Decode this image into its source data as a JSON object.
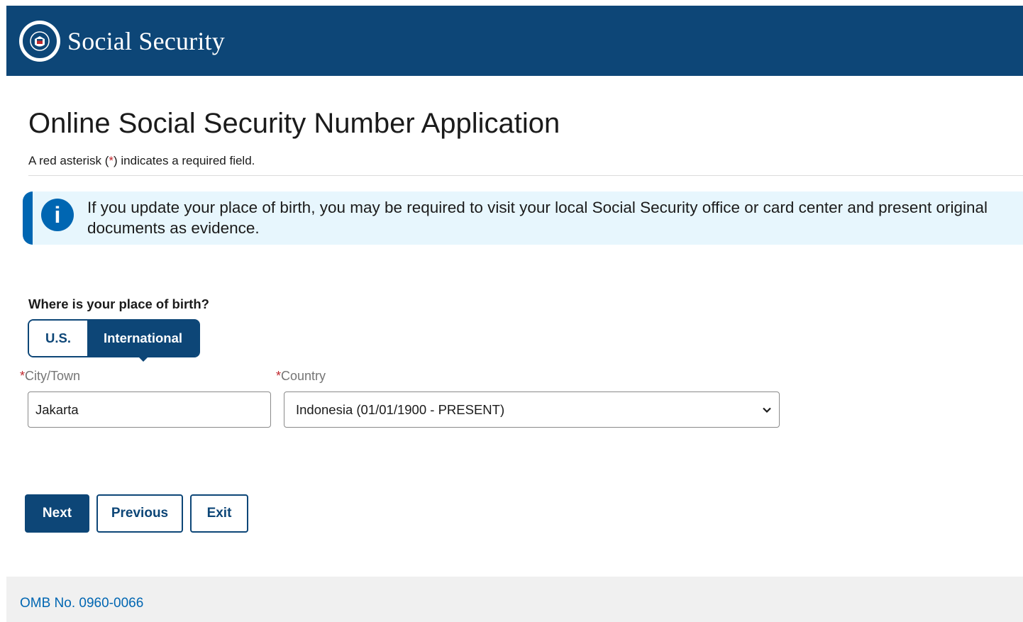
{
  "header": {
    "brand": "Social Security",
    "logo_icon": "ssa-seal-icon"
  },
  "page": {
    "title": "Online Social Security Number Application",
    "required_note_before": "A red asterisk (",
    "required_note_star": "*",
    "required_note_after": ") indicates a required field."
  },
  "alert": {
    "icon": "info-icon",
    "text": "If you update your place of birth, you may be required to visit your local Social Security office or card center and present original documents as evidence."
  },
  "birthplace": {
    "question": "Where is your place of birth?",
    "options": [
      "U.S.",
      "International"
    ],
    "selected": "International"
  },
  "fields": {
    "city_label": "City/Town",
    "city_value": "Jakarta",
    "country_label": "Country",
    "country_value": "Indonesia (01/01/1900 - PRESENT)",
    "required_marker": "*"
  },
  "buttons": {
    "next": "Next",
    "previous": "Previous",
    "exit": "Exit"
  },
  "footer": {
    "omb": "OMB No. 0960-0066"
  },
  "colors": {
    "brand_blue": "#0d4677",
    "info_blue": "#0066b2",
    "alert_bg": "#e7f6fd",
    "required_red": "#c0272d"
  }
}
